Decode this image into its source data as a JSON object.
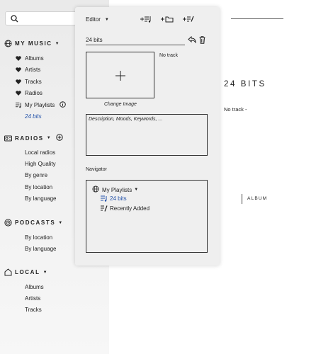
{
  "sidebar": {
    "search": {
      "placeholder": ""
    },
    "my_music": {
      "title": "MY MUSIC",
      "items": [
        {
          "label": "Albums",
          "icon": "heart-icon"
        },
        {
          "label": "Artists",
          "icon": "heart-icon"
        },
        {
          "label": "Tracks",
          "icon": "heart-icon"
        },
        {
          "label": "Radios",
          "icon": "heart-icon"
        },
        {
          "label": "My Playlists",
          "icon": "playlist-icon"
        }
      ],
      "active_playlist": "24 bits"
    },
    "radios": {
      "title": "RADIOS",
      "items": [
        "Local radios",
        "High Quality",
        "By genre",
        "By location",
        "By language"
      ]
    },
    "podcasts": {
      "title": "PODCASTS",
      "items": [
        "By location",
        "By language"
      ]
    },
    "local": {
      "title": "LOCAL",
      "items": [
        "Albums",
        "Artists",
        "Tracks"
      ]
    }
  },
  "main": {
    "title": "24 BITS",
    "subtitle": "No track -",
    "album_label": "ALBUM"
  },
  "editor": {
    "header": "Editor",
    "playlist_name": "24 bits",
    "image_status": "No track",
    "change_image": "Change Image",
    "description_placeholder": "Description, Moods, Keywords, ...",
    "navigator_label": "Navigator",
    "navigator": {
      "root": "My Playlists",
      "items": [
        {
          "label": "24 bits",
          "selected": true
        },
        {
          "label": "Recently Added",
          "selected": false
        }
      ]
    }
  },
  "colors": {
    "accent": "#1f4fa8",
    "sidebar_bg": "#efefef",
    "panel_bg": "#efefef",
    "text": "#222222"
  }
}
